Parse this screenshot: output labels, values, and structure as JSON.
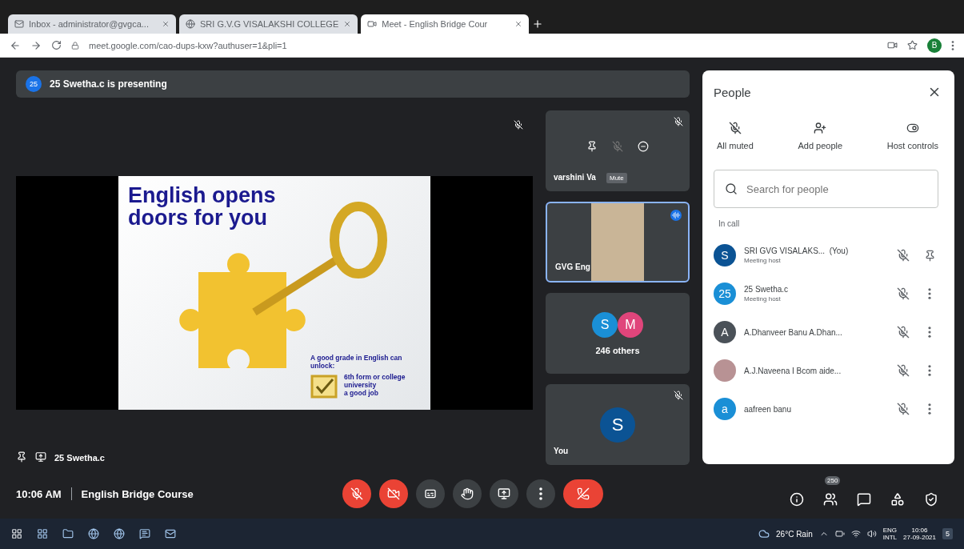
{
  "browser": {
    "tabs": [
      {
        "title": "Inbox - administrator@gvgca...",
        "selected": false,
        "kind": "mail"
      },
      {
        "title": "SRI G.V.G VISALAKSHI COLLEGE",
        "selected": false,
        "kind": "site"
      },
      {
        "title": "Meet - English Bridge Cour",
        "selected": true,
        "kind": "meet"
      }
    ],
    "url": "meet.google.com/cao-dups-kxw?authuser=1&pli=1",
    "profile_initial": "B"
  },
  "banner": {
    "badge": "25",
    "text": "25 Swetha.c is presenting"
  },
  "slide": {
    "title": "English opens doors for you",
    "caption": "A good grade in English can unlock:",
    "items": [
      "6th form or college",
      "university",
      "a good job"
    ]
  },
  "presenter": {
    "name": "25 Swetha.c"
  },
  "tiles": [
    {
      "kind": "hover",
      "name": "varshini Va",
      "tooltip": "Mute",
      "selected": false
    },
    {
      "kind": "video",
      "name": "GVG Eng",
      "selected": true
    },
    {
      "kind": "group",
      "avatars": [
        {
          "initial": "S",
          "color": "#1a8fd6"
        },
        {
          "initial": "M",
          "color": "#e0457b"
        }
      ],
      "label": "246 others",
      "selected": false
    },
    {
      "kind": "self",
      "initial": "S",
      "name": "You",
      "selected": false
    }
  ],
  "people": {
    "title": "People",
    "actions": [
      {
        "kind": "mute",
        "label": "All muted"
      },
      {
        "kind": "add",
        "label": "Add people"
      },
      {
        "kind": "host",
        "label": "Host controls"
      }
    ],
    "search": {
      "placeholder": "Search for people"
    },
    "section": "In call",
    "members": [
      {
        "initial": "S",
        "color": "#0b5394",
        "name": "SRI GVG VISALAKS...",
        "tag": "(You)",
        "role": "Meeting host",
        "kind": "self"
      },
      {
        "initial": "25",
        "color": "#1a8fd6",
        "name": "25 Swetha.c",
        "role": "Meeting host",
        "kind": "other"
      },
      {
        "initial": "A",
        "color": "#4a5158",
        "name": "A.Dhanveer Banu A.Dhan...",
        "kind": "other"
      },
      {
        "kind": "other",
        "name": "A.J.Naveena I Bcom aide..."
      },
      {
        "initial": "a",
        "color": "#1a8fd6",
        "name": "aafreen banu",
        "kind": "other"
      }
    ]
  },
  "footer": {
    "time": "10:06 AM",
    "meeting": "English Bridge Course",
    "controls": [
      {
        "kind": "mic"
      },
      {
        "kind": "cam"
      },
      {
        "kind": "cc"
      },
      {
        "kind": "hand"
      },
      {
        "kind": "present"
      },
      {
        "kind": "more"
      },
      {
        "kind": "end"
      }
    ],
    "right": [
      {
        "kind": "info"
      },
      {
        "kind": "people",
        "badge": "250"
      },
      {
        "kind": "chat"
      },
      {
        "kind": "activities"
      },
      {
        "kind": "safety"
      }
    ]
  },
  "taskbar": {
    "weather": "26°C Rain",
    "lang_top": "ENG",
    "lang_bottom": "INTL",
    "time": "10:06",
    "date": "27-09-2021",
    "notifications": "5"
  }
}
